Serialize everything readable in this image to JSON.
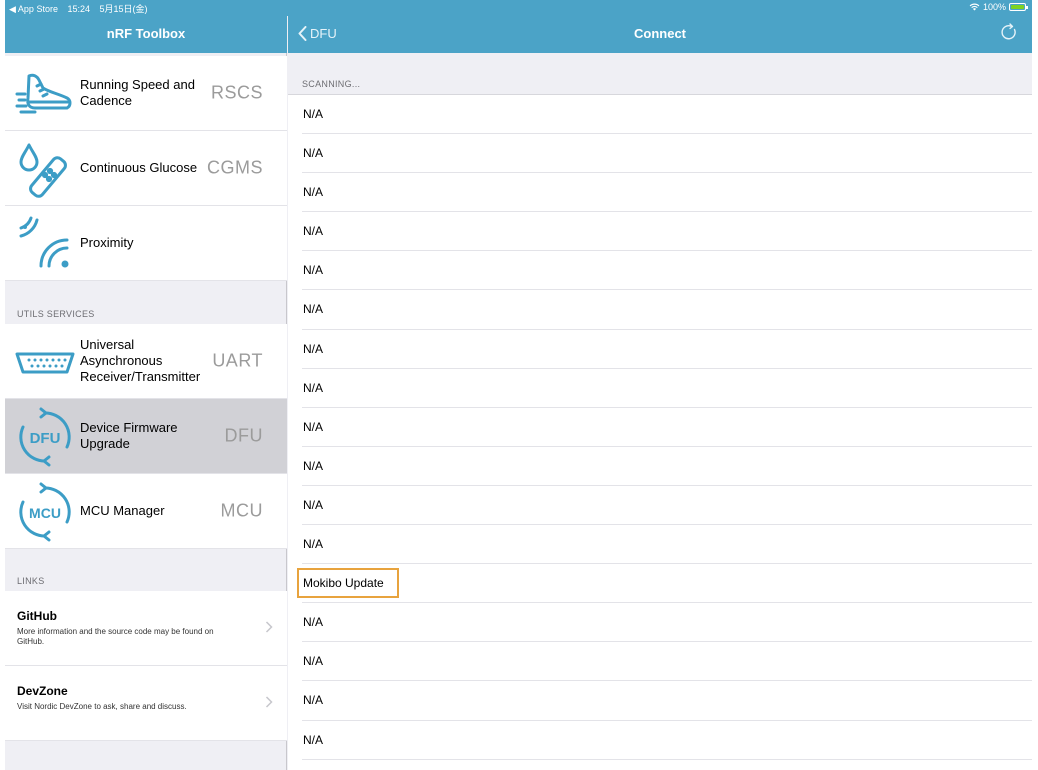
{
  "status_bar": {
    "back_app": "◀ App Store",
    "time": "15:24",
    "date": "5月15日(金)",
    "battery": "100%"
  },
  "master": {
    "title": "nRF Toolbox",
    "profiles": [
      {
        "label": "Running Speed and Cadence",
        "abbr": "RSCS",
        "icon": "running-shoe-icon"
      },
      {
        "label": "Continuous Glucose",
        "abbr": "CGMS",
        "icon": "glucose-patch-icon"
      },
      {
        "label": "Proximity",
        "abbr": "",
        "icon": "proximity-signal-icon"
      }
    ],
    "utils_header": "UTILS SERVICES",
    "utils": [
      {
        "label": "Universal Asynchronous Receiver/Transmitter",
        "abbr": "UART",
        "icon": "serial-port-icon"
      },
      {
        "label": "Device Firmware Upgrade",
        "abbr": "DFU",
        "icon": "dfu-icon",
        "icon_text": "DFU",
        "selected": true
      },
      {
        "label": "MCU Manager",
        "abbr": "MCU",
        "icon": "mcu-icon",
        "icon_text": "MCU"
      }
    ],
    "links_header": "LINKS",
    "links": [
      {
        "title": "GitHub",
        "description": "More information and the source code may be found on GitHub."
      },
      {
        "title": "DevZone",
        "description": "Visit Nordic DevZone to ask, share and discuss."
      }
    ]
  },
  "detail": {
    "back_label": "DFU",
    "title": "Connect",
    "scanning_header": "SCANNING...",
    "devices": [
      {
        "name": "N/A"
      },
      {
        "name": "N/A"
      },
      {
        "name": "N/A"
      },
      {
        "name": "N/A"
      },
      {
        "name": "N/A"
      },
      {
        "name": "N/A"
      },
      {
        "name": "N/A"
      },
      {
        "name": "N/A"
      },
      {
        "name": "N/A"
      },
      {
        "name": "N/A"
      },
      {
        "name": "N/A"
      },
      {
        "name": "N/A"
      },
      {
        "name": "Mokibo Update",
        "highlighted": true
      },
      {
        "name": "N/A"
      },
      {
        "name": "N/A"
      },
      {
        "name": "N/A"
      },
      {
        "name": "N/A"
      }
    ]
  },
  "colors": {
    "nav_bar": "#4ba3c7",
    "icon_blue": "#3c9dc6",
    "highlight_border": "#e8a33d",
    "selected_row": "#d1d1d6"
  }
}
